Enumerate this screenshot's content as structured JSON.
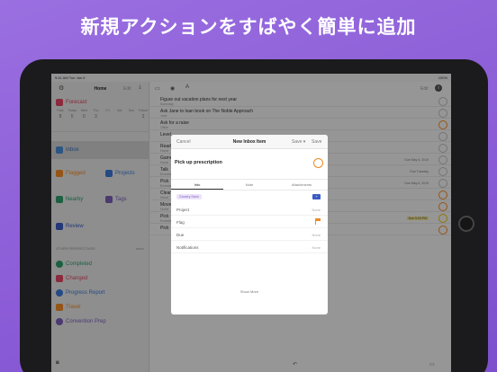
{
  "headline": "新規アクションをすばやく簡単に追加",
  "status": {
    "time": "9:41 AM",
    "date": "Tue Jan 9",
    "battery": "100%"
  },
  "sidebar": {
    "title": "Home",
    "edit": "Edit",
    "forecast": {
      "label": "Forecast",
      "days": [
        "Past",
        "Today",
        "Wed",
        "Thu",
        "Fri",
        "Sat",
        "Sun",
        "Future"
      ],
      "counts": [
        "8",
        "5",
        "0",
        "3",
        "",
        "",
        "",
        "2"
      ]
    },
    "inbox": "Inbox",
    "tiles": {
      "flagged": "Flagged",
      "projects": "Projects",
      "nearby": "Nearby",
      "tags": "Tags",
      "review": "Review"
    },
    "other_header": "OTHER PERSPECTIVES",
    "more": "more",
    "perspectives": [
      {
        "label": "Completed",
        "color": "#2e9b6a"
      },
      {
        "label": "Changed",
        "color": "#e04563"
      },
      {
        "label": "Progress Report",
        "color": "#3b78d8"
      },
      {
        "label": "Travel",
        "color": "#f08a24"
      },
      {
        "label": "Convention Prep",
        "color": "#7a5cb5"
      }
    ]
  },
  "list": {
    "edit": "Edit",
    "rows": [
      {
        "title": "Figure out vacation plans for next year",
        "sub": "Someday",
        "due": "",
        "circle": "gray"
      },
      {
        "title": "Ask Jane to loan book on The Noble Approach",
        "sub": "Jane",
        "due": "",
        "circle": "gray"
      },
      {
        "title": "Ask for a raise",
        "sub": "Office",
        "due": "",
        "circle": "orange"
      },
      {
        "title": "Level",
        "sub": "",
        "due": "",
        "circle": "gray"
      },
      {
        "title": "Read",
        "sub": "Home",
        "due": "",
        "circle": "gray"
      },
      {
        "title": "Game",
        "sub": "Home",
        "due": "Due May 6, 2019",
        "circle": "gray"
      },
      {
        "title": "Talk",
        "sub": "Errands",
        "due": "Due Tuesday",
        "circle": "gray"
      },
      {
        "title": "Pick",
        "sub": "Errands",
        "due": "Due May 6, 2019",
        "circle": "gray"
      },
      {
        "title": "Clean",
        "sub": "Home",
        "due": "",
        "circle": "orange"
      },
      {
        "title": "Move",
        "sub": "Home",
        "due": "",
        "circle": "orange"
      },
      {
        "title": "Pick",
        "sub": "Errands",
        "due": "Due 5:00 PM",
        "circle": "yellow"
      },
      {
        "title": "Pick",
        "sub": "",
        "due": "",
        "circle": "orange"
      }
    ]
  },
  "modal": {
    "cancel": "Cancel",
    "title": "New Inbox Item",
    "save_menu": "Save ▾",
    "save": "Save",
    "task_name": "Pick up prescription",
    "tabs": [
      "Info",
      "Note",
      "Attachments"
    ],
    "tag": "Grocery Store",
    "fields": [
      {
        "key": "Project",
        "value": "None"
      },
      {
        "key": "Flag",
        "value": ""
      },
      {
        "key": "Due",
        "value": "None"
      },
      {
        "key": "Notifications",
        "value": "None"
      }
    ],
    "show_more": "Show More"
  }
}
